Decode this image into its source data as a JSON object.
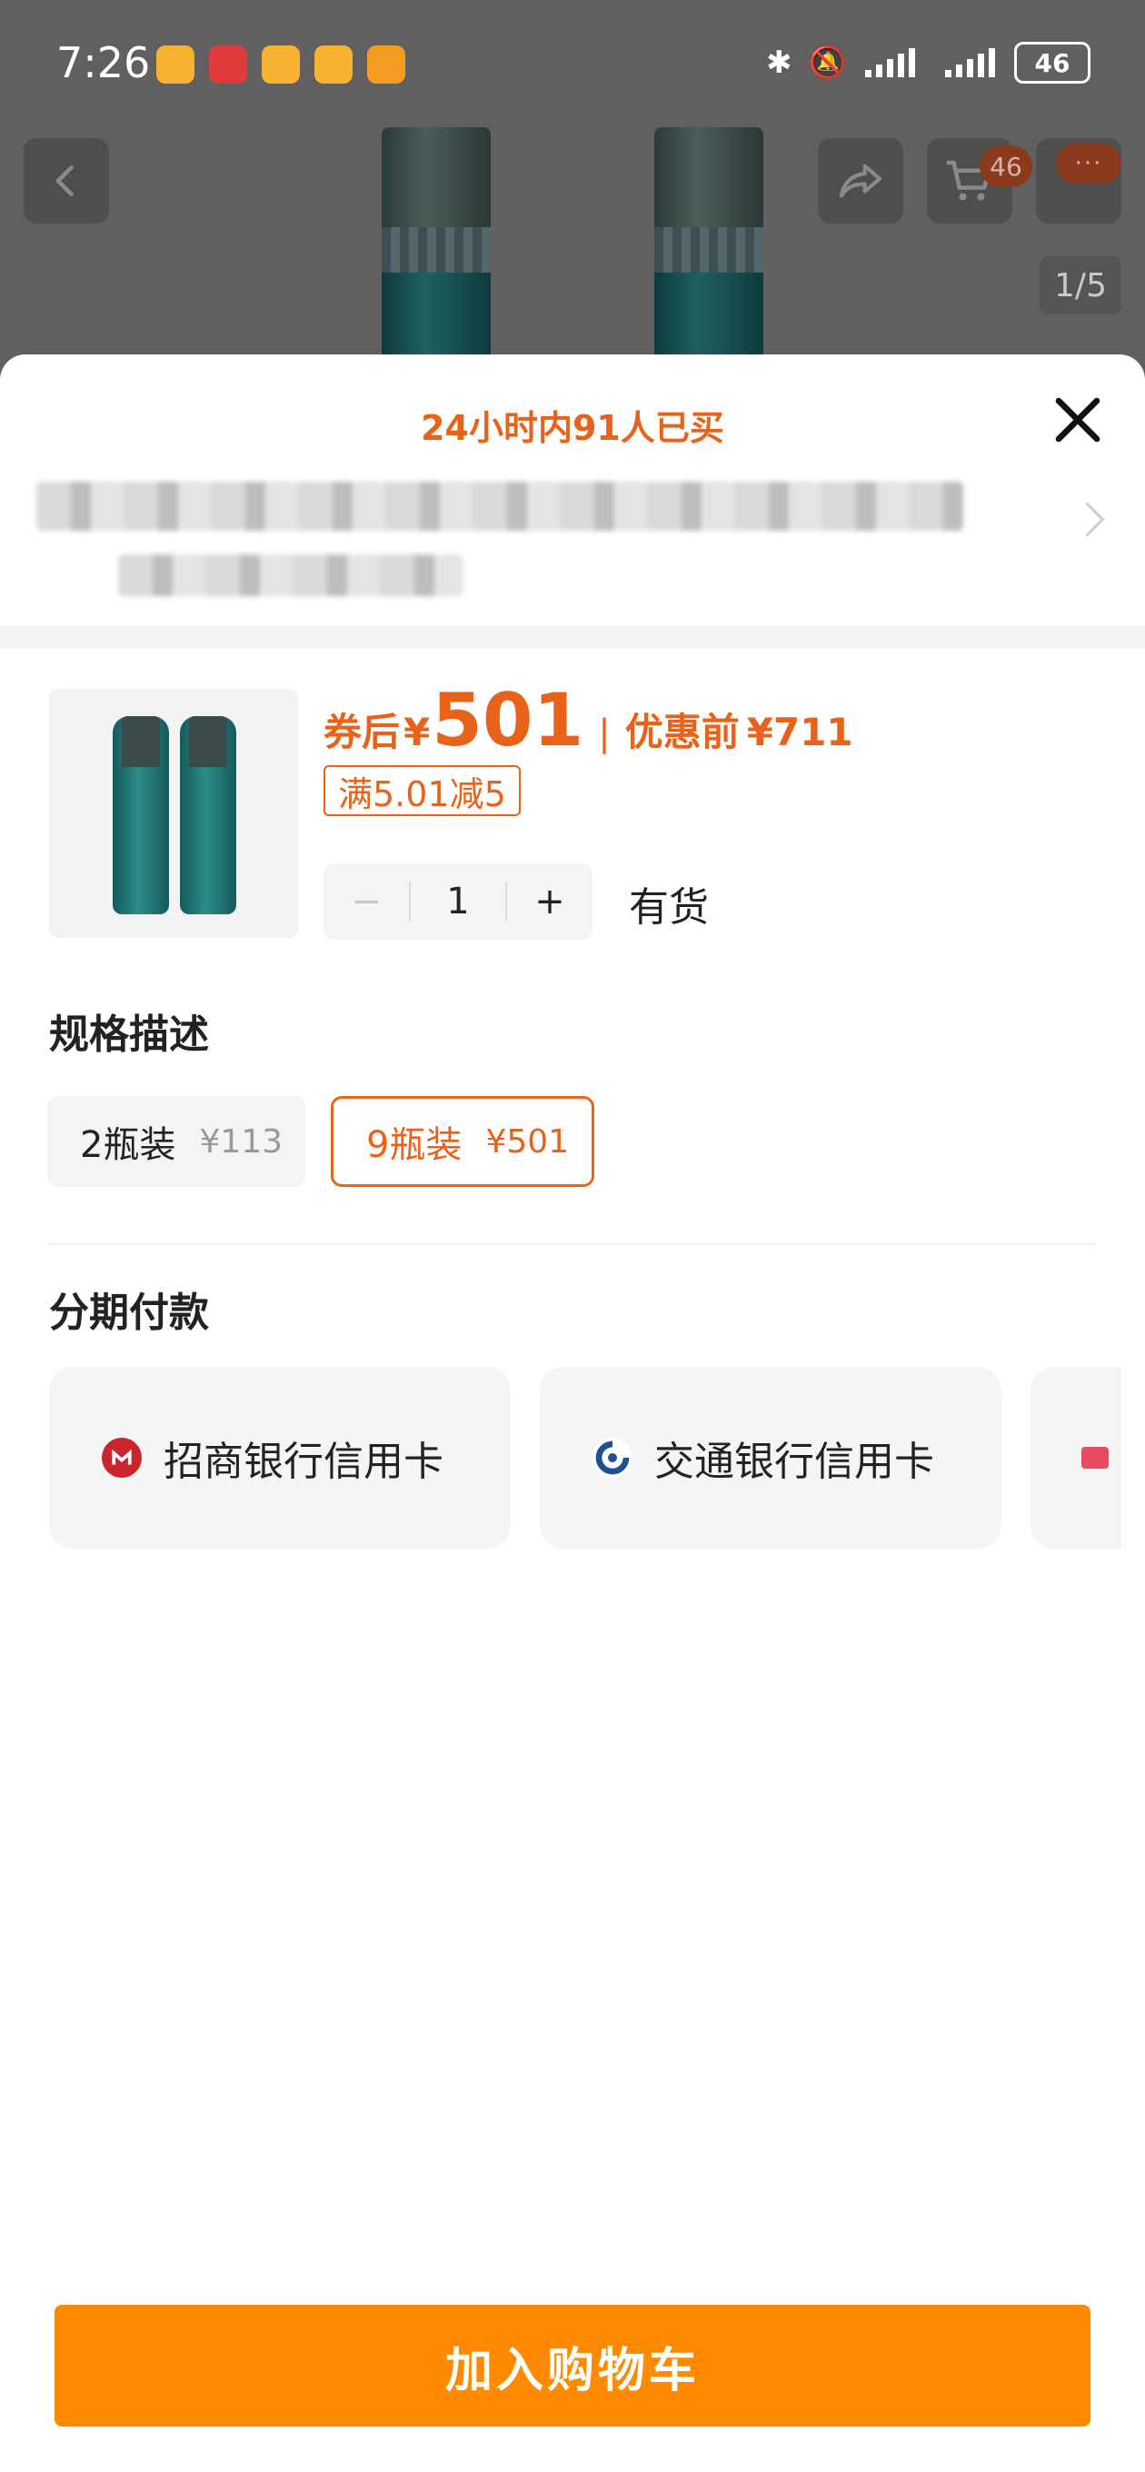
{
  "status_bar": {
    "time": "7:26",
    "battery": "46"
  },
  "background_page": {
    "cart_count": "46",
    "more_label": "···",
    "image_indicator": "1/5"
  },
  "sheet": {
    "purchase_notice": "24小时内91人已买",
    "product": {
      "price_after_label": "券后",
      "currency_symbol": "¥",
      "price_after": "501",
      "price_separator": "|",
      "price_before_label": "优惠前",
      "price_before": "¥711",
      "coupon": "满5.01减5",
      "quantity": "1",
      "qty_minus": "−",
      "qty_plus": "+",
      "stock_status": "有货"
    },
    "spec_section": {
      "title": "规格描述",
      "options": [
        {
          "label": "2瓶装",
          "price": "¥113",
          "selected": false
        },
        {
          "label": "9瓶装",
          "price": "¥501",
          "selected": true
        }
      ]
    },
    "installment_section": {
      "title": "分期付款",
      "banks": [
        {
          "name": "招商银行信用卡",
          "icon": "cmb-logo-icon"
        },
        {
          "name": "交通银行信用卡",
          "icon": "bocom-logo-icon"
        }
      ]
    },
    "add_to_cart": "加入购物车"
  },
  "colors": {
    "accent": "#e8621a",
    "cta": "#ff8a00"
  }
}
